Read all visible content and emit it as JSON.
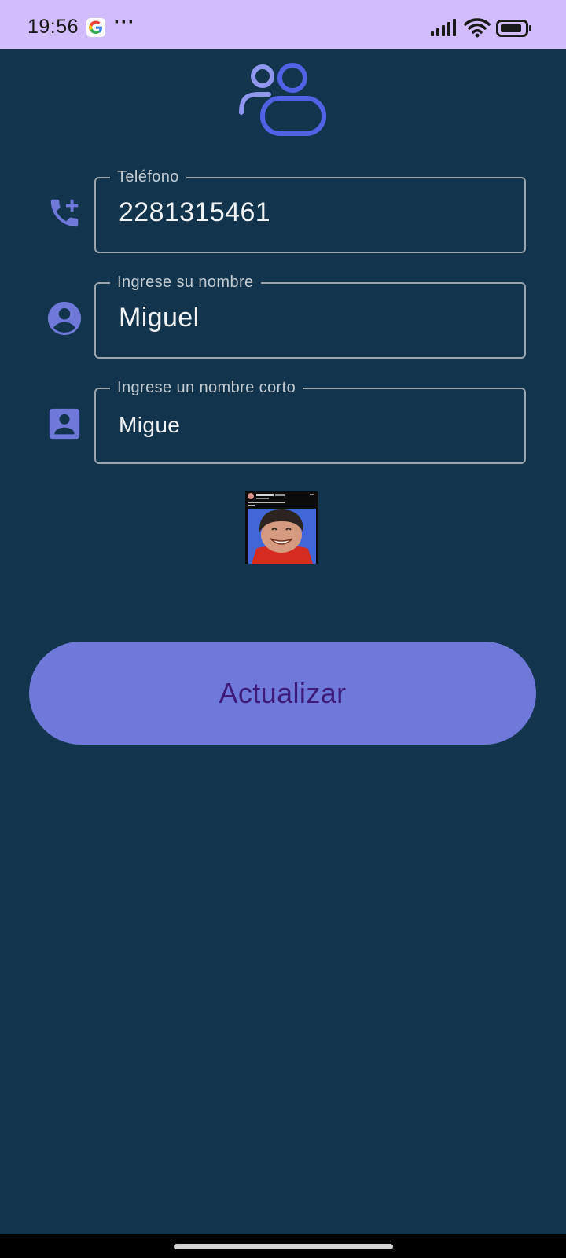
{
  "status_bar": {
    "time": "19:56",
    "google_icon": "google-g-icon",
    "more_label": "···",
    "signal_icon": "cellular-signal-icon",
    "wifi_icon": "wifi-icon",
    "battery_icon": "battery-icon"
  },
  "header": {
    "logo_icon": "people-group-icon"
  },
  "form": {
    "fields": [
      {
        "icon": "add-call-icon",
        "label": "Teléfono",
        "value": "2281315461"
      },
      {
        "icon": "account-circle-icon",
        "label": "Ingrese su nombre",
        "value": "Miguel"
      },
      {
        "icon": "contact-card-icon",
        "label": "Ingrese un nombre corto",
        "value": "Migue"
      }
    ],
    "photo": "profile-photo"
  },
  "actions": {
    "update_label": "Actualizar"
  },
  "colors": {
    "background": "#12354d",
    "status_bar": "#d1bdfd",
    "accent": "#6e79da",
    "button_text": "#3e1a7b",
    "logo_blue": "#4f63e4",
    "field_border": "#9aa4ad"
  }
}
